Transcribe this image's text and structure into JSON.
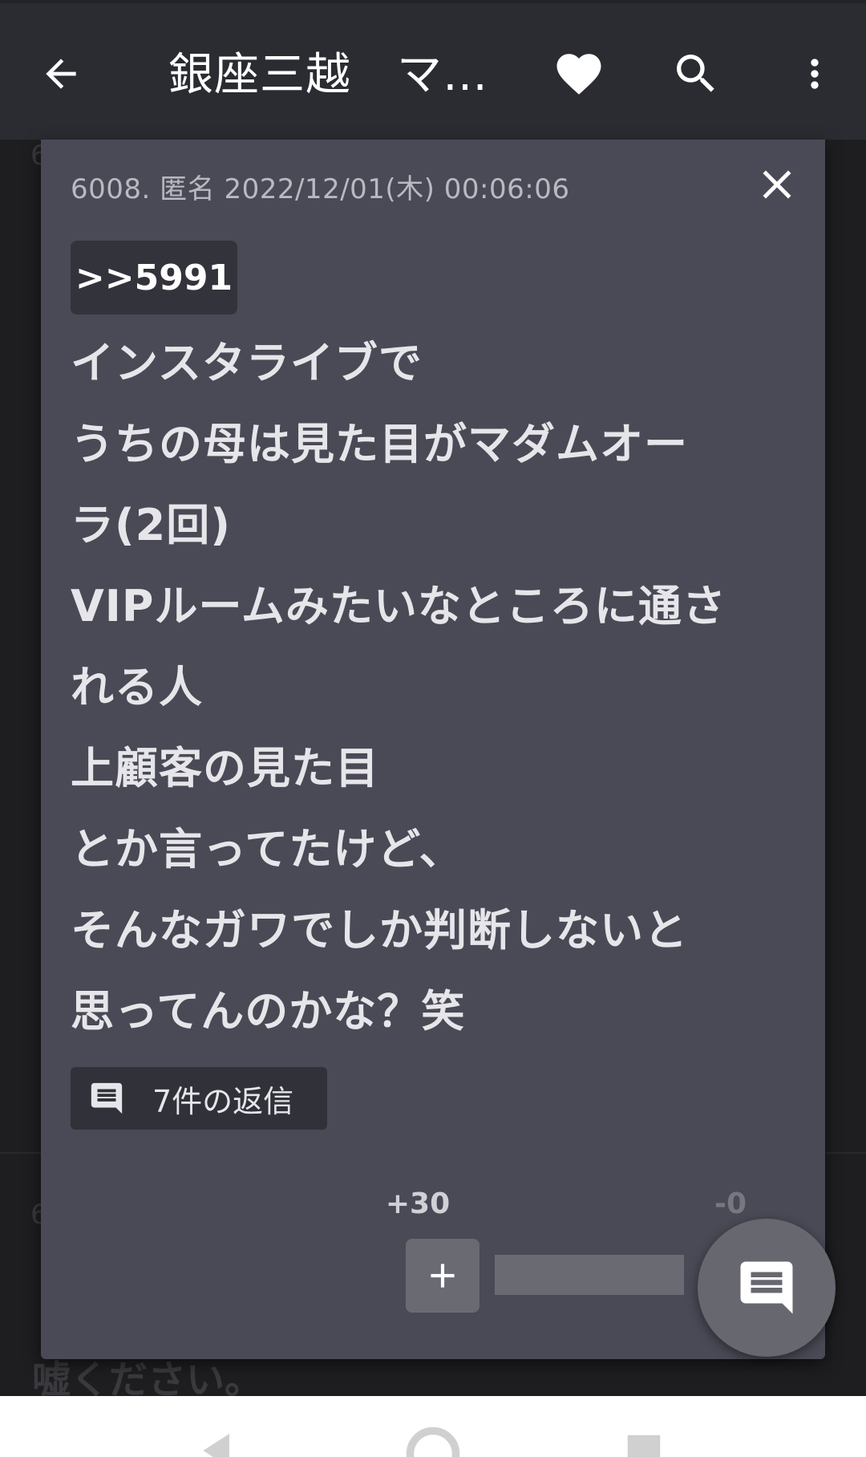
{
  "appbar": {
    "title": "銀座三越　マダム",
    "icons": [
      "arrow-back-icon",
      "heart-icon",
      "search-icon",
      "more-vert-icon"
    ]
  },
  "background": {
    "partial_number": "6",
    "bottom_line": "嘘ください。"
  },
  "post": {
    "meta": "6008. 匿名  2022/12/01(木)  00:06:06",
    "anchor": ">>5991",
    "lines": [
      "インスタライブで",
      "うちの母は見た目がマダムオー",
      "ラ(2回)",
      "VIPルームみたいなところに通さ",
      "れる人",
      "上顧客の見た目",
      "とか言ってたけど、",
      "そんなガワでしか判断しないと",
      "思ってんのかな？笑"
    ],
    "reply_label": "7件の返信",
    "votes": {
      "plus": "+30",
      "minus": "-0"
    }
  },
  "colors": {
    "appbar": "#2b2c32",
    "popup": "#4a4a56",
    "chip": "#33333b",
    "fab": "#67676f"
  }
}
